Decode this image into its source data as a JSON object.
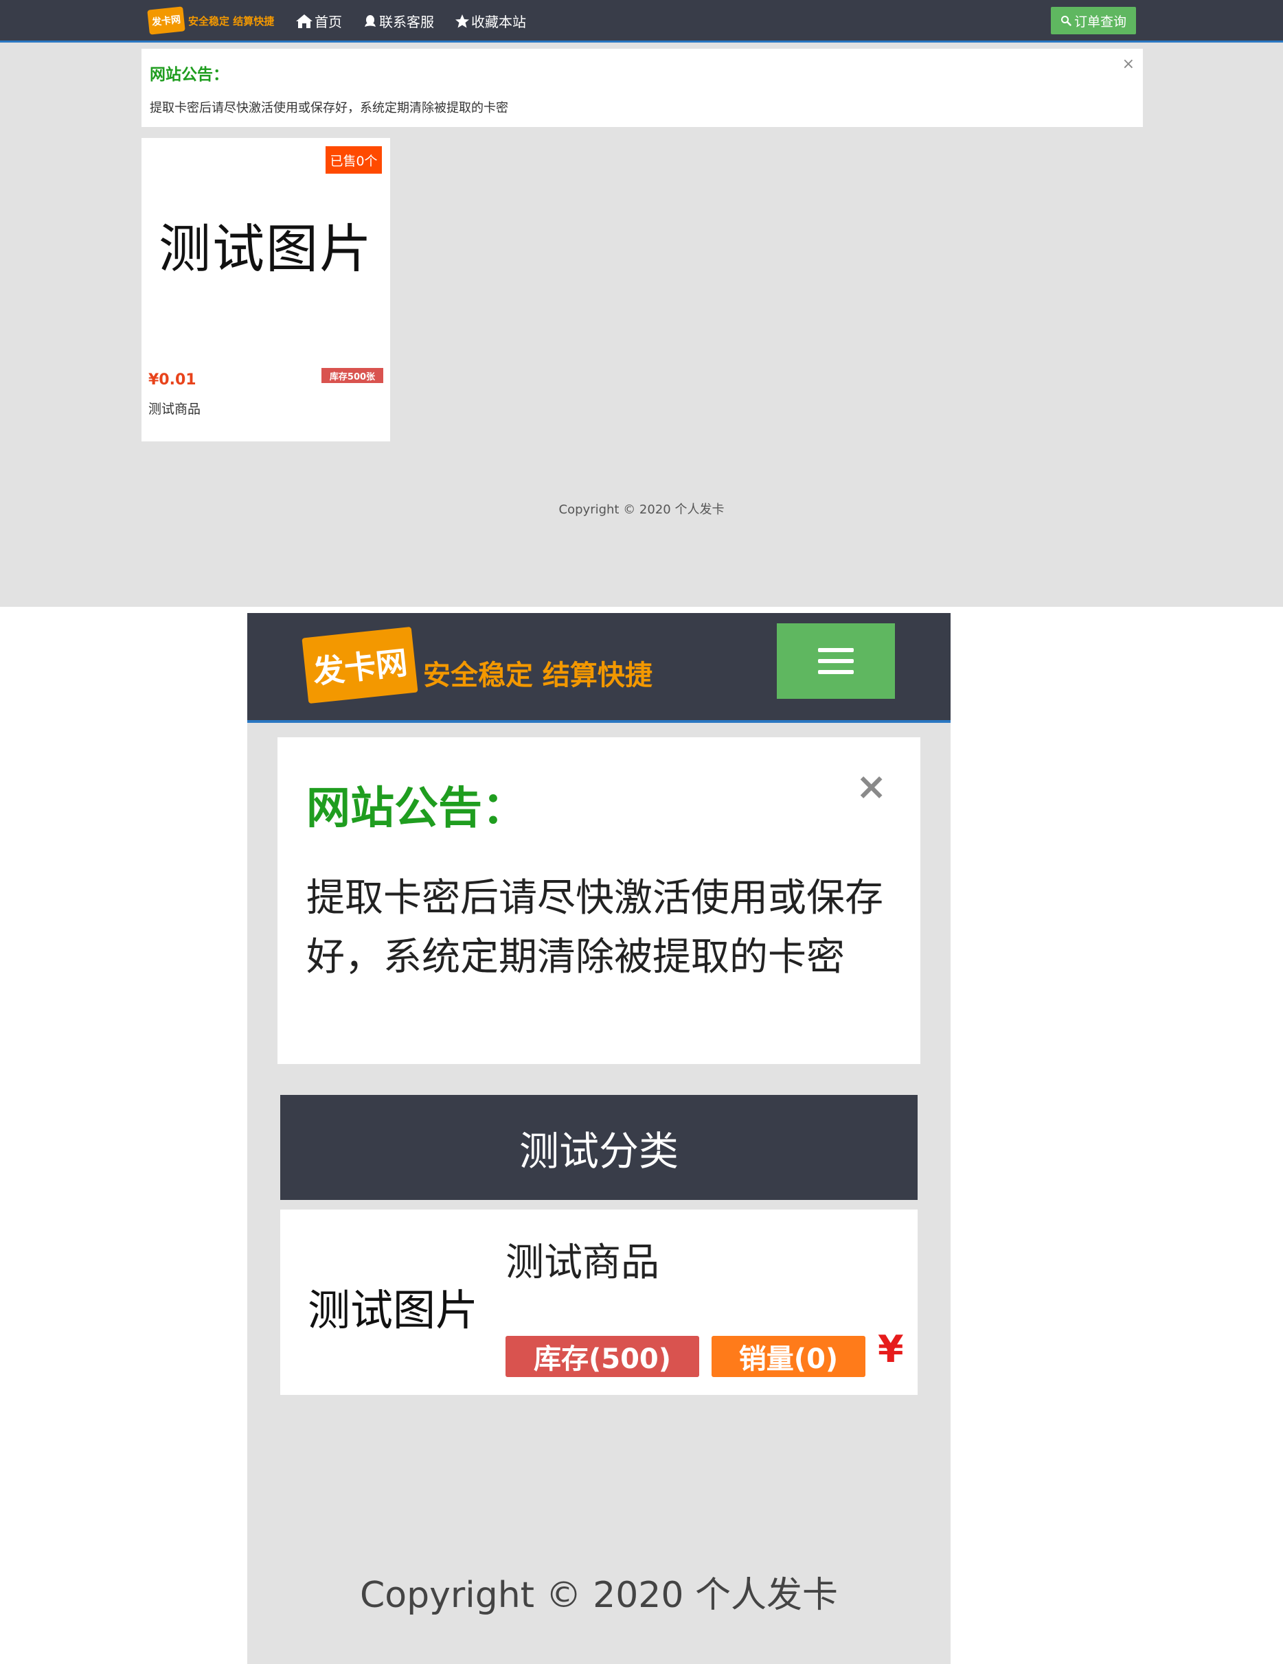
{
  "brand": {
    "logo_mark": "发卡网",
    "slogan": "安全稳定 结算快捷",
    "accent_color": "#f39800"
  },
  "nav": {
    "items": [
      {
        "icon": "home-icon",
        "label": "首页"
      },
      {
        "icon": "qq-icon",
        "label": "联系客服"
      },
      {
        "icon": "star-icon",
        "label": "收藏本站"
      }
    ],
    "query_label": "订单查询",
    "query_icon": "search-icon",
    "menu_icon": "hamburger-menu-icon"
  },
  "notice": {
    "title": "网站公告：",
    "body": "提取卡密后请尽快激活使用或保存好，系统定期清除被提取的卡密",
    "close_glyph": "×"
  },
  "category": {
    "name": "测试分类"
  },
  "product": {
    "image_text": "测试图片",
    "name": "测试商品",
    "price": "¥0.01",
    "sold_badge": "已售0个",
    "stock_badge": "库存500张",
    "stock_label": "库存(500)",
    "sales_label": "销量(0)",
    "price_symbol": "¥"
  },
  "footer": {
    "copyright": "Copyright © 2020 个人发卡"
  },
  "colors": {
    "nav_bg": "#393d49",
    "query_btn": "#5fb760",
    "notice_title": "#1f9d1f",
    "sold_badge": "#ff4a00",
    "stock_badge": "#d9534f",
    "sales_badge": "#ff7b1a",
    "price": "#e61b1b"
  }
}
